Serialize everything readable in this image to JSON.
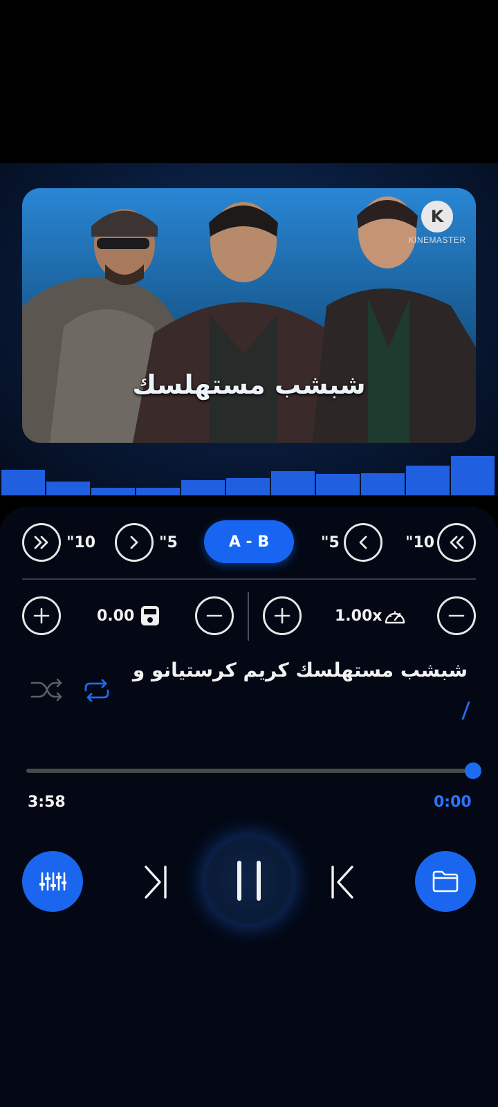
{
  "artwork": {
    "title": "شبشب مستهلسك",
    "watermark_letter": "K",
    "watermark_text": "KINEMASTER"
  },
  "visualizer": {
    "levels": [
      0.62,
      0.33,
      0.19,
      0.18,
      0.36,
      0.42,
      0.58,
      0.51,
      0.54,
      0.72,
      0.95
    ],
    "color": "#1f5fe0"
  },
  "seek_controls": {
    "forward_10_label": "\"10",
    "forward_5_label": "\"5",
    "ab_label": "A - B",
    "back_5_label": "\"5",
    "back_10_label": "\"10"
  },
  "pitch": {
    "value": "0.00",
    "icon": "tuner-icon"
  },
  "speed": {
    "value": "1.00x",
    "icon": "speedometer-icon"
  },
  "lyrics": {
    "text": "شبشب مستهلسك   كريم كرستيانو و"
  },
  "playback": {
    "duration": "3:58",
    "position": "0:00",
    "progress": 0.0,
    "shuffle_on": false,
    "repeat_on": true
  },
  "colors": {
    "accent": "#1a66ee",
    "panel": "#030814"
  }
}
